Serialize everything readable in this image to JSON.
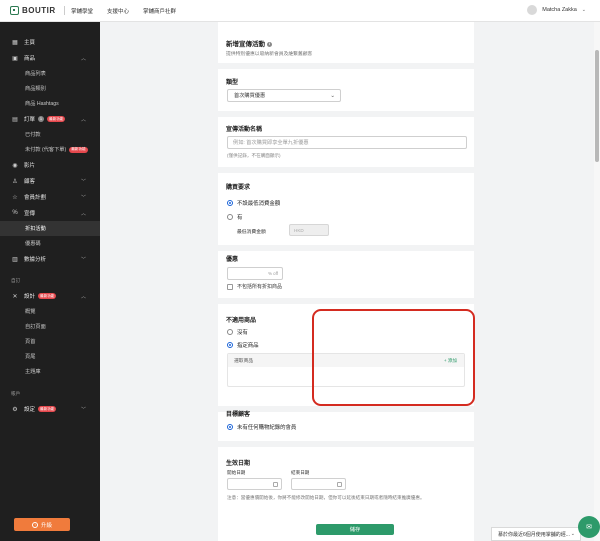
{
  "topbar": {
    "logo_text": "BOUTIR",
    "nav": [
      "掌舖學堂",
      "支援中心",
      "掌舖商戶社群"
    ],
    "user_name": "Matcha Zakka"
  },
  "sidebar": {
    "items": [
      {
        "icon": "home-icon",
        "label": "主頁"
      },
      {
        "icon": "box-icon",
        "label": "商品"
      },
      {
        "sub": "商品列表"
      },
      {
        "sub": "商品類別"
      },
      {
        "sub": "商品 Hashtags"
      },
      {
        "icon": "receipt-icon",
        "label": "訂單",
        "count": "1",
        "badge": "最新功能"
      },
      {
        "sub": "已付款"
      },
      {
        "sub": "未付款 (代客下單)",
        "badge": "最新功能"
      },
      {
        "icon": "movie-icon",
        "label": "影片"
      },
      {
        "icon": "user-icon",
        "label": "顧客"
      },
      {
        "icon": "star-icon",
        "label": "會員計劃"
      },
      {
        "icon": "percent-icon",
        "label": "宣傳"
      },
      {
        "sub": "折扣活動"
      },
      {
        "sub": "優惠碼"
      },
      {
        "icon": "chart-icon",
        "label": "數據分析"
      }
    ],
    "section_custom": "自訂",
    "design": {
      "label": "設計",
      "badge": "最新功能"
    },
    "design_subs": [
      "概覽",
      "自訂頁面",
      "頁首",
      "頁尾",
      "主題庫"
    ],
    "section_account": "帳戶",
    "settings": {
      "label": "設定",
      "badge": "最新功能"
    },
    "upgrade_label": "升級"
  },
  "form": {
    "header_title": "新增宣傳活動",
    "header_desc": "提供特別優惠以吸納新會員及維繫舊顧客",
    "type_label": "類型",
    "type_value": "首次購買優惠",
    "name_label": "宣傳活動名稱",
    "name_placeholder": "例如: 首次購買即享全單九折優惠",
    "name_hint": "(僅供記錄，不在購面顯示)",
    "req_label": "購買要求",
    "req_opt_none": "不設最低消費金額",
    "req_opt_yes": "有",
    "min_spend_label": "最低消費金額",
    "min_spend_placeholder": "HKD",
    "discount_label": "優惠",
    "discount_suffix": "% off",
    "no_discount_check": "不包括所有折扣商品",
    "excl_label": "不適用商品",
    "excl_opt_none": "沒有",
    "excl_opt_specific": "指定商品",
    "select_products": "選取商品",
    "add_product": "+ 添加",
    "target_label": "目標顧客",
    "target_opt": "未有任何購物紀錄的會員",
    "date_label": "生效日期",
    "start_label": "開始日期",
    "end_label": "結束日期",
    "date_note": "注意：當優惠價開始後，你將不能修改開始日期，但你可以延後結束日期或者隨時結束推廣優惠。",
    "save_label": "儲存"
  },
  "promo_text": "慕於你最近6個月使用掌舖的經...",
  "colors": {
    "accent": "#2d9a6a",
    "radio_blue": "#1b64d8",
    "highlight_red": "#d42b20",
    "sidebar_bg": "#1f1f1f",
    "upgrade_orange": "#f07b3c"
  }
}
